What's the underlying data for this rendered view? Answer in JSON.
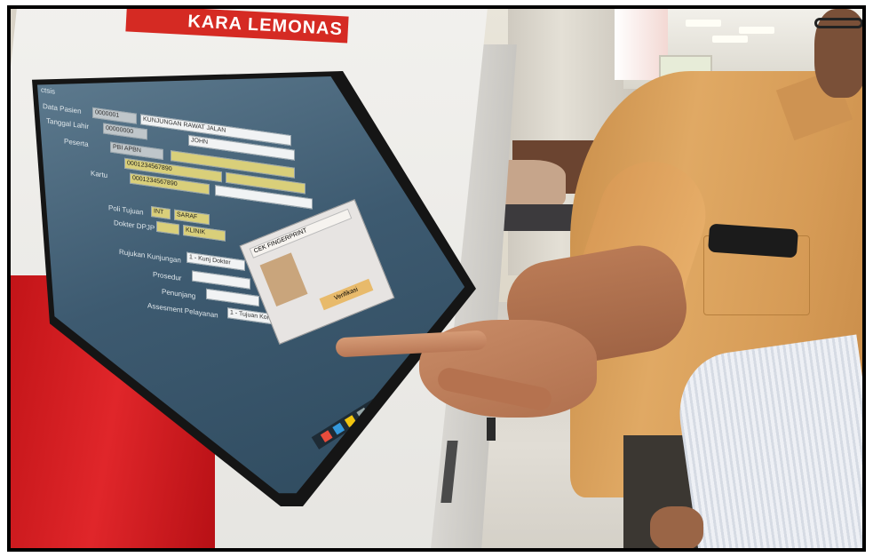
{
  "scene": {
    "description_free": true,
    "kiosk_banner": "KARA LEMONAS",
    "colors": {
      "kiosk_red": "#d52a23",
      "shirt": "#e0a964",
      "screen": "#3d5a70"
    }
  },
  "screen": {
    "title": "ctsis",
    "labels": [
      "Data Pasien",
      "Tanggal Lahir",
      "Peserta",
      "Kartu",
      "Poli Tujuan",
      "Dokter DPJP",
      "Rujukan Kunjungan",
      "Prosedur",
      "Penunjang",
      "Assesment Pelayanan"
    ],
    "fields": [
      "0000001",
      "KUNJUNGAN RAWAT JALAN",
      "00000000",
      "JOHN",
      "PBI APBN",
      "0001234567890",
      "0001234567890",
      "INT",
      "SARAF",
      "KLINIK",
      "1 - Kunj Dokter",
      "1 - Tujuan Kontrol"
    ],
    "popup_title": "CEK FINGERPRINT",
    "popup_status": "Verifikasi"
  }
}
